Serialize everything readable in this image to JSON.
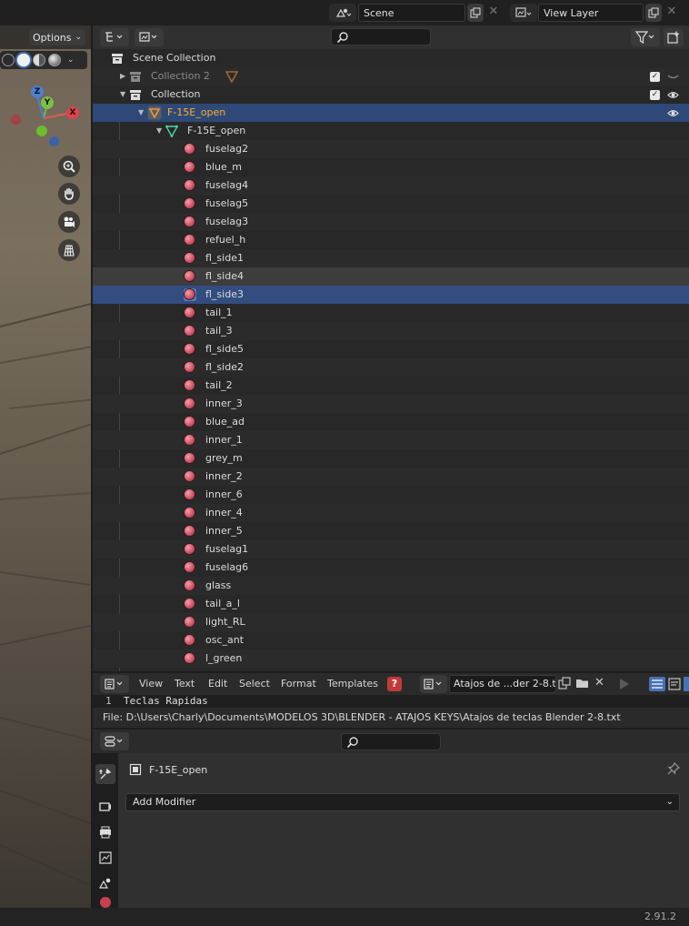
{
  "topbar": {
    "scene_label": "Scene",
    "view_layer_label": "View Layer"
  },
  "viewport": {
    "options_label": "Options",
    "axes": {
      "x": "X",
      "y": "Y",
      "z": "Z"
    }
  },
  "outliner": {
    "search_placeholder": "",
    "rows": [
      {
        "label": "Scene Collection"
      },
      {
        "label": "Collection 2"
      },
      {
        "label": "Collection"
      },
      {
        "label": "F-15E_open"
      },
      {
        "label": "F-15E_open"
      },
      {
        "label": "fuselag2"
      },
      {
        "label": "blue_m"
      },
      {
        "label": "fuselag4"
      },
      {
        "label": "fuselag5"
      },
      {
        "label": "fuselag3"
      },
      {
        "label": "refuel_h"
      },
      {
        "label": "fl_side1"
      },
      {
        "label": "fl_side4"
      },
      {
        "label": "fl_side3"
      },
      {
        "label": "tail_1"
      },
      {
        "label": "tail_3"
      },
      {
        "label": "fl_side5"
      },
      {
        "label": "fl_side2"
      },
      {
        "label": "tail_2"
      },
      {
        "label": "inner_3"
      },
      {
        "label": "blue_ad"
      },
      {
        "label": "inner_1"
      },
      {
        "label": "grey_m"
      },
      {
        "label": "inner_2"
      },
      {
        "label": "inner_6"
      },
      {
        "label": "inner_4"
      },
      {
        "label": "inner_5"
      },
      {
        "label": "fuselag1"
      },
      {
        "label": "fuselag6"
      },
      {
        "label": "glass"
      },
      {
        "label": "tail_a_l"
      },
      {
        "label": "light_RL"
      },
      {
        "label": "osc_ant"
      },
      {
        "label": "l_green"
      }
    ]
  },
  "texteditor": {
    "menus": [
      "View",
      "Text",
      "Edit",
      "Select",
      "Format",
      "Templates"
    ],
    "file_name": "Atajos de ...der 2-8.txt",
    "line_number": "1",
    "line_text": "Teclas Rapidas",
    "status": "File: D:\\Users\\Charly\\Documents\\MODELOS 3D\\BLENDER - ATAJOS KEYS\\Atajos de teclas Blender 2-8.txt"
  },
  "properties": {
    "object_name": "F-15E_open",
    "add_modifier_label": "Add Modifier"
  },
  "statusbar": {
    "version": "2.91.2"
  },
  "colors": {
    "selection": "#334d80",
    "active_text": "#ffaf29",
    "material": "#d2566a",
    "mesh_green": "#4cd6a6",
    "orange_object": "#e59a55"
  }
}
